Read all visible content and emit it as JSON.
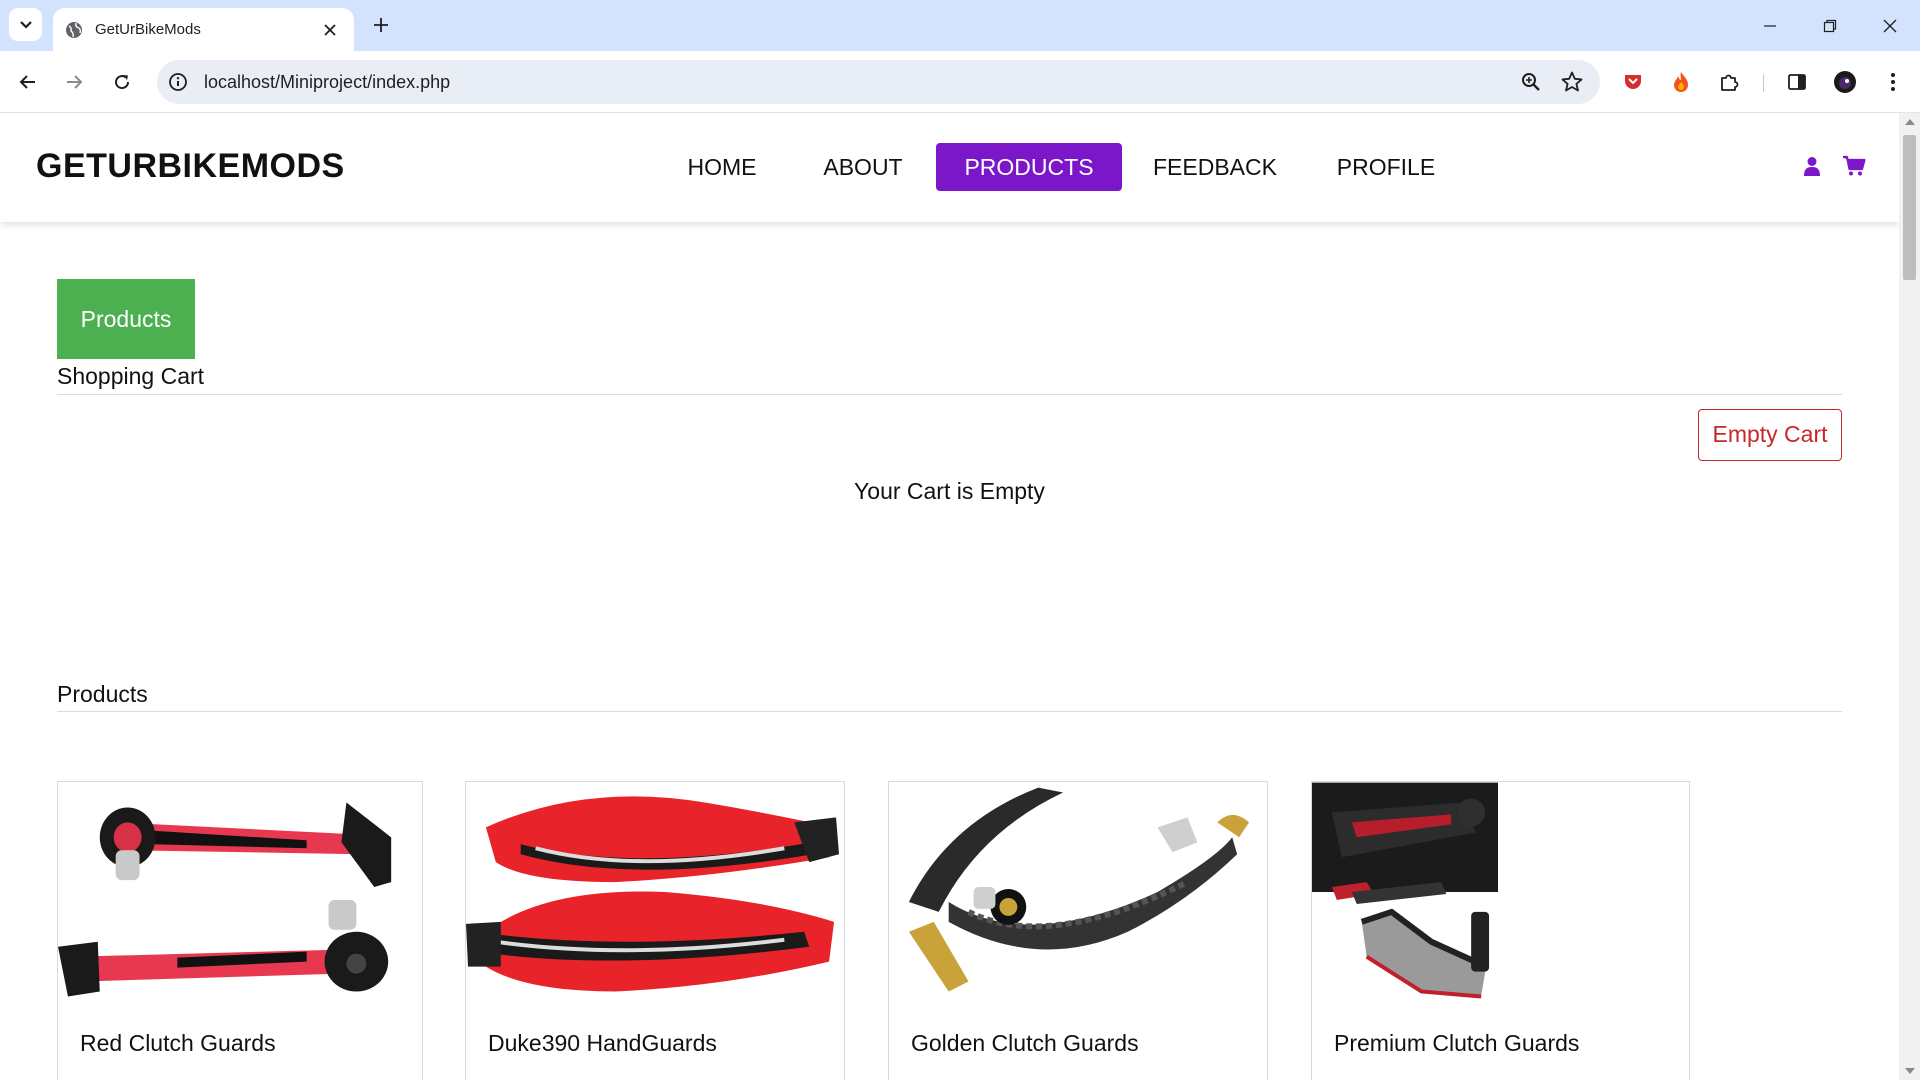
{
  "browser": {
    "tab_title": "GetUrBikeMods",
    "url": "localhost/Miniproject/index.php"
  },
  "site": {
    "logo": "GETURBIKEMODS",
    "nav": [
      "HOME",
      "ABOUT",
      "PRODUCTS",
      "FEEDBACK",
      "PROFILE"
    ],
    "active_nav": "PRODUCTS",
    "accent_color": "#7b17c9"
  },
  "cart": {
    "products_button": "Products",
    "title": "Shopping Cart",
    "empty_button": "Empty Cart",
    "empty_message": "Your Cart is Empty"
  },
  "products": {
    "title": "Products",
    "items": [
      {
        "name": "Red Clutch Guards"
      },
      {
        "name": "Duke390 HandGuards"
      },
      {
        "name": "Golden Clutch Guards"
      },
      {
        "name": "Premium Clutch Guards"
      }
    ]
  }
}
